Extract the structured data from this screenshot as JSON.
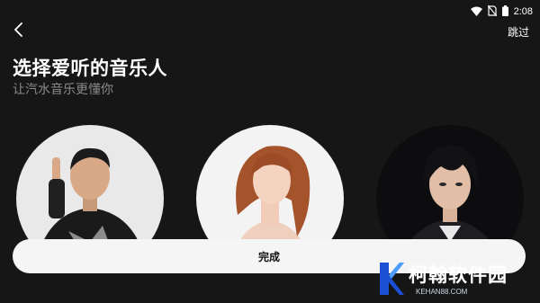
{
  "status_bar": {
    "time": "2:08",
    "icons": [
      "wifi-icon",
      "no-sim-icon",
      "battery-icon"
    ]
  },
  "header": {
    "back_icon": "chevron-left-icon",
    "skip_label": "跳过"
  },
  "title": "选择爱听的音乐人",
  "subtitle": "让汽水音乐更懂你",
  "artists": [
    {
      "avatar": "male singer in black outfit"
    },
    {
      "avatar": "female singer with auburn hair"
    },
    {
      "avatar": "male singer with hair fringe"
    }
  ],
  "done_label": "完成",
  "watermark": {
    "text": "柯翰软件园",
    "url": "KEHAN88.COM"
  },
  "colors": {
    "background": "#161616",
    "button_bg": "#f5f5f5",
    "subtitle": "#8a8a8a",
    "logo_blue": "#1a4fd6"
  }
}
